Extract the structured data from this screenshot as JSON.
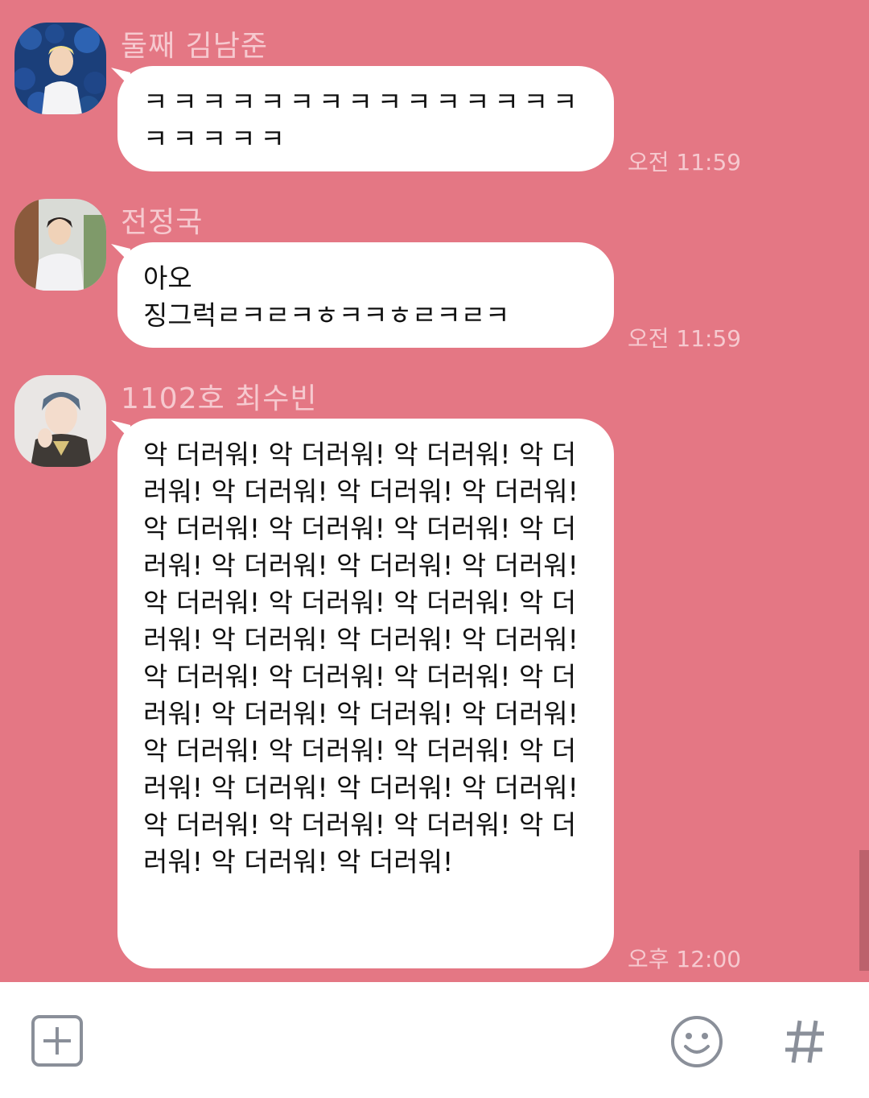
{
  "messages": [
    {
      "sender": "둘째 김남준",
      "text": "ㅋㅋㅋㅋㅋㅋㅋㅋㅋㅋㅋㅋㅋㅋㅋ\nㅋㅋㅋㅋㅋ",
      "time": "오전 11:59"
    },
    {
      "sender": "전정국",
      "text": "아오\n징그럭ㄹㅋㄹㅋㅎㅋㅋㅎㄹㅋㄹㅋ",
      "time": "오전 11:59"
    },
    {
      "sender": "1102호 최수빈",
      "text": "악 더러워! 악 더러워! 악 더러워! 악 더러워! 악 더러워! 악 더러워! 악 더러워! 악 더러워! 악 더러워! 악 더러워! 악 더러워! 악 더러워! 악 더러워! 악 더러워! 악 더러워! 악 더러워! 악 더러워! 악 더러워! 악 더러워! 악 더러워! 악 더러워! 악 더러워! 악 더러워! 악 더러워! 악 더러워! 악 더러워! 악 더러워! 악 더러워! 악 더러워! 악 더러워! 악 더러워! 악 더러워! 악 더러워! 악 더러워! 악 더러워! 악 더러워! 악 더러워! 악 더러워! 악 더러워! 악 더러워! 악 더러워!",
      "time": "오후 12:00"
    }
  ],
  "toolbar": {
    "add_icon": "plus-square-icon",
    "emoji_icon": "smiley-icon",
    "hashtag_icon": "hashtag-icon"
  },
  "colors": {
    "background": "#e47784",
    "bubble": "#ffffff",
    "meta_text": "#f6c9cf",
    "icon": "#8a8f99"
  }
}
